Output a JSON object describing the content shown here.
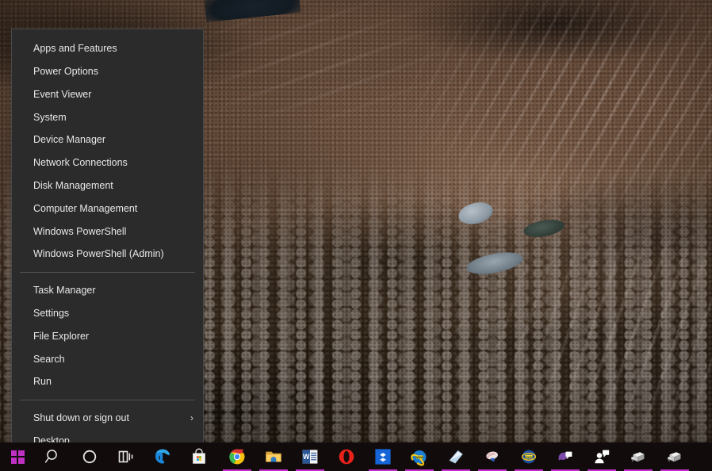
{
  "desktop": {
    "wallpaper_name": "alpine-mountain-wallpaper",
    "wallpaper_description": "Aerial view of rocky alpine mountain slope with snow streaks and small tarns"
  },
  "context_menu": {
    "name": "win-x-power-user-menu",
    "background_color": "#2b2b2b",
    "border_color": "#4a4a4a",
    "text_color": "#e8e8e8",
    "groups": [
      {
        "items": [
          {
            "label": "Apps and Features",
            "submenu": false
          },
          {
            "label": "Power Options",
            "submenu": false
          },
          {
            "label": "Event Viewer",
            "submenu": false
          },
          {
            "label": "System",
            "submenu": false
          },
          {
            "label": "Device Manager",
            "submenu": false
          },
          {
            "label": "Network Connections",
            "submenu": false
          },
          {
            "label": "Disk Management",
            "submenu": false
          },
          {
            "label": "Computer Management",
            "submenu": false
          },
          {
            "label": "Windows PowerShell",
            "submenu": false
          },
          {
            "label": "Windows PowerShell (Admin)",
            "submenu": false
          }
        ]
      },
      {
        "items": [
          {
            "label": "Task Manager",
            "submenu": false
          },
          {
            "label": "Settings",
            "submenu": false
          },
          {
            "label": "File Explorer",
            "submenu": false
          },
          {
            "label": "Search",
            "submenu": false
          },
          {
            "label": "Run",
            "submenu": false
          }
        ]
      },
      {
        "items": [
          {
            "label": "Shut down or sign out",
            "submenu": true,
            "chevron": "›"
          },
          {
            "label": "Desktop",
            "submenu": false
          }
        ]
      }
    ]
  },
  "taskbar": {
    "background_color": "#110c0b",
    "accent_color": "#c22ec9",
    "start_button": {
      "label": "Start",
      "icon": "windows-logo-icon",
      "color": "#bf30c4"
    },
    "items": [
      {
        "icon": "search-icon",
        "label": "Search",
        "running": false
      },
      {
        "icon": "cortana-icon",
        "label": "Cortana",
        "running": false
      },
      {
        "icon": "task-view-icon",
        "label": "Task View",
        "running": false
      },
      {
        "icon": "edge-icon",
        "label": "Microsoft Edge",
        "running": false
      },
      {
        "icon": "microsoft-store-icon",
        "label": "Microsoft Store",
        "running": false
      },
      {
        "icon": "chrome-icon",
        "label": "Google Chrome",
        "running": true
      },
      {
        "icon": "file-explorer-icon",
        "label": "File Explorer",
        "running": true
      },
      {
        "icon": "word-icon",
        "label": "Microsoft Word",
        "running": true
      },
      {
        "icon": "opera-icon",
        "label": "Opera",
        "running": false
      },
      {
        "icon": "dropbox-icon",
        "label": "Dropbox",
        "running": true
      },
      {
        "icon": "internet-explorer-icon",
        "label": "Internet Explorer",
        "running": true
      },
      {
        "icon": "scanner-icon",
        "label": "Scanner",
        "running": true
      },
      {
        "icon": "shell-icon",
        "label": "Shell",
        "running": true
      },
      {
        "icon": "globe-icon",
        "label": "Globe",
        "running": true
      },
      {
        "icon": "chat-purple-icon",
        "label": "Chat",
        "running": true
      },
      {
        "icon": "contact-icon",
        "label": "People",
        "running": true
      },
      {
        "icon": "printer-icon",
        "label": "Printer",
        "running": true
      },
      {
        "icon": "printer-alt-icon",
        "label": "Printer 2",
        "running": true
      }
    ]
  }
}
